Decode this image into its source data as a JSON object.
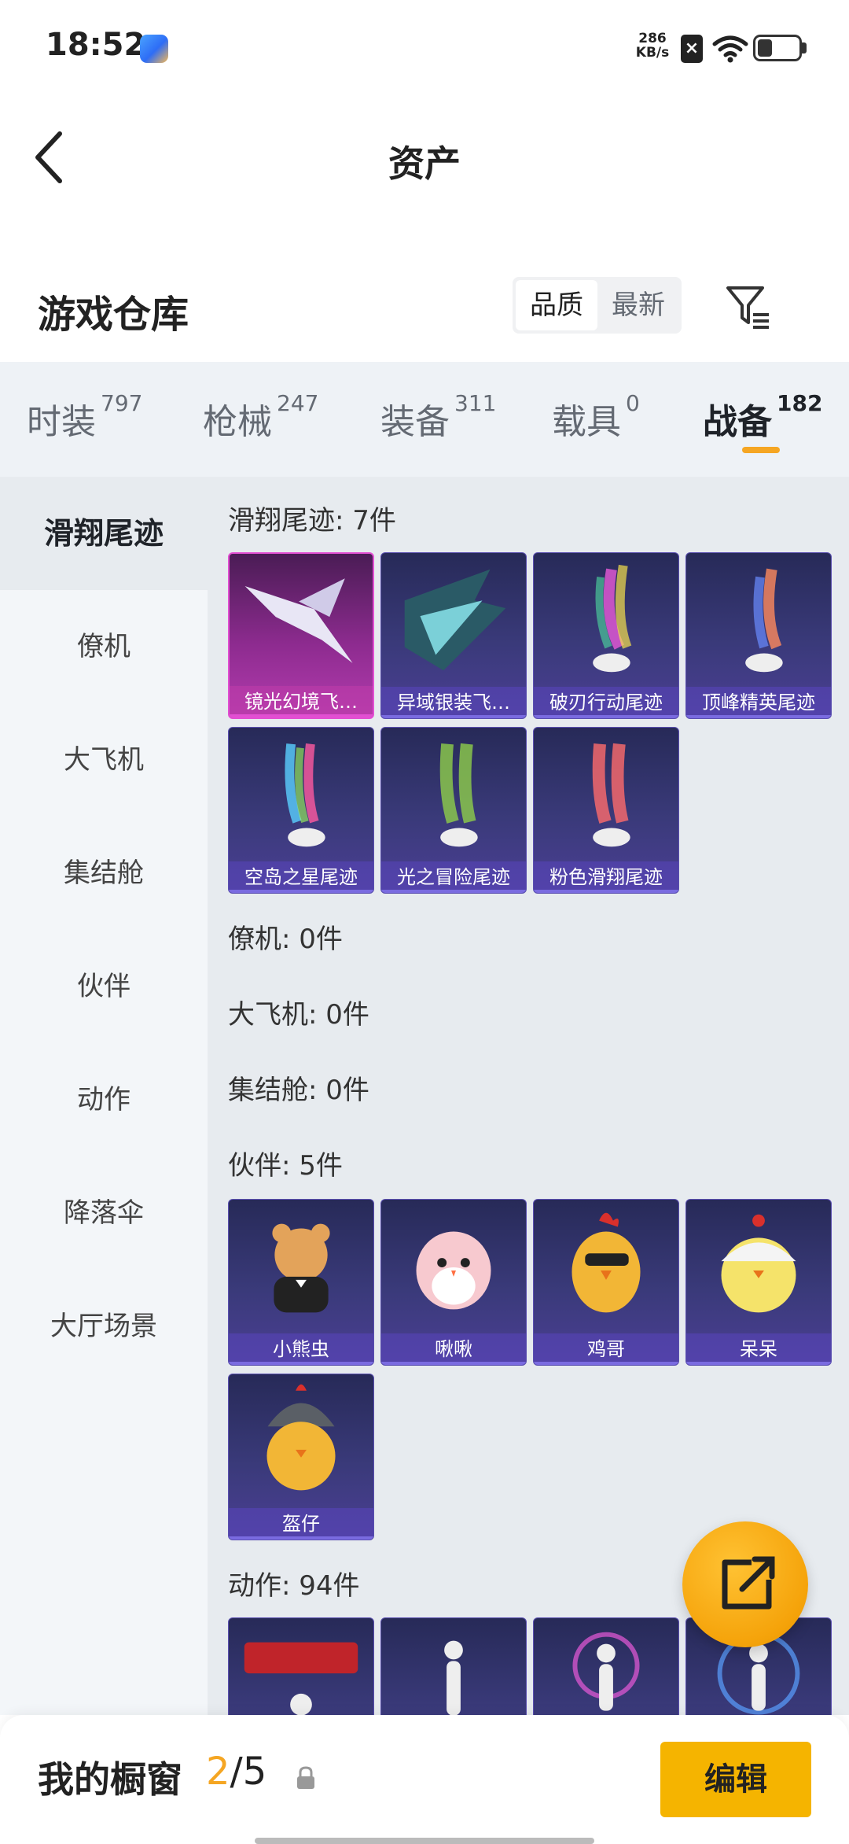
{
  "status": {
    "time": "18:52",
    "net_speed_value": "286",
    "net_speed_unit": "KB/s"
  },
  "nav": {
    "title": "资产"
  },
  "warehouse": {
    "title": "游戏仓库",
    "sort_quality": "品质",
    "sort_newest": "最新"
  },
  "tabs": [
    {
      "label": "时装",
      "count": "797"
    },
    {
      "label": "枪械",
      "count": "247"
    },
    {
      "label": "装备",
      "count": "311"
    },
    {
      "label": "载具",
      "count": "0"
    },
    {
      "label": "战备",
      "count": "182"
    }
  ],
  "sidebar": [
    "滑翔尾迹",
    "僚机",
    "大飞机",
    "集结舱",
    "伙伴",
    "动作",
    "降落伞",
    "大厅场景"
  ],
  "sections": {
    "glide": {
      "title": "滑翔尾迹: 7件",
      "items": [
        "镜光幻境飞…",
        "异域银装飞…",
        "破刃行动尾迹",
        "顶峰精英尾迹",
        "空岛之星尾迹",
        "光之冒险尾迹",
        "粉色滑翔尾迹"
      ]
    },
    "wingman": {
      "title": "僚机: 0件"
    },
    "plane": {
      "title": "大飞机: 0件"
    },
    "pod": {
      "title": "集结舱: 0件"
    },
    "companion": {
      "title": "伙伴: 5件",
      "items": [
        "小熊虫",
        "啾啾",
        "鸡哥",
        "呆呆",
        "盔仔"
      ]
    },
    "emote": {
      "title": "动作: 94件"
    }
  },
  "bottom": {
    "label": "我的橱窗",
    "current": "2",
    "total": "/5",
    "edit": "编辑"
  },
  "colors": {
    "accent": "#f5a623",
    "edit_button": "#f5b400",
    "card_purple": "#3a3a7a",
    "card_pink": "#b33cae"
  }
}
